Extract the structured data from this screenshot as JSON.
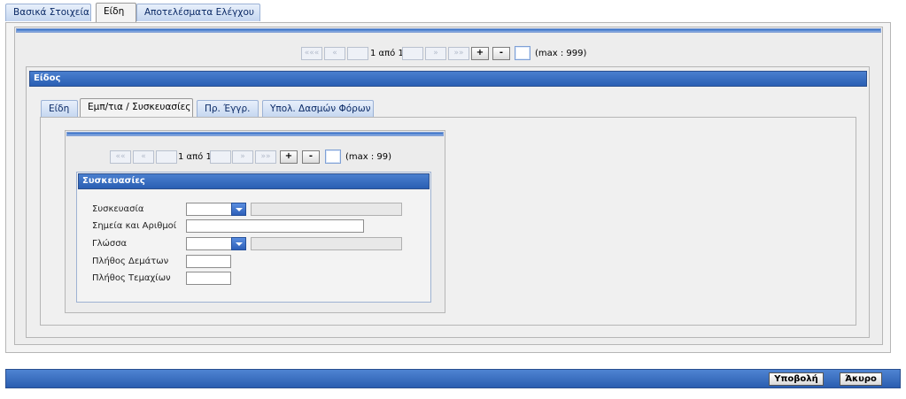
{
  "top_tabs": [
    {
      "label": "Βασικά Στοιχεία",
      "active": false
    },
    {
      "label": "Είδη",
      "active": true
    },
    {
      "label": "Αποτελέσματα Ελέγχου",
      "active": false
    }
  ],
  "outer_pager": {
    "first": "«««",
    "prev": "«",
    "status": "1 από 1",
    "next": "»",
    "last": "»»",
    "add": "+",
    "remove": "-",
    "max": "(max : 999)"
  },
  "item_section": {
    "title": "Είδος",
    "tabs": [
      {
        "label": "Είδη",
        "active": false
      },
      {
        "label": "Εμπ/τια / Συσκευασίες",
        "active": true
      },
      {
        "label": "Πρ. Έγγρ.",
        "active": false
      },
      {
        "label": "Υπολ. Δασμών Φόρων",
        "active": false
      }
    ]
  },
  "inner_pager": {
    "first": "««",
    "prev": "«",
    "status": "1 από 1",
    "next": "»",
    "last": "»»",
    "add": "+",
    "remove": "-",
    "max": "(max : 99)"
  },
  "packages": {
    "title": "Συσκευασίες",
    "fields": {
      "package_label": "Συσκευασία",
      "marks_label": "Σημεία και Αριθμοί",
      "language_label": "Γλώσσα",
      "bundles_label": "Πλήθος Δεμάτων",
      "pieces_label": "Πλήθος Τεμαχίων"
    }
  },
  "footer": {
    "submit": "Υποβολή",
    "cancel": "Άκυρο"
  }
}
